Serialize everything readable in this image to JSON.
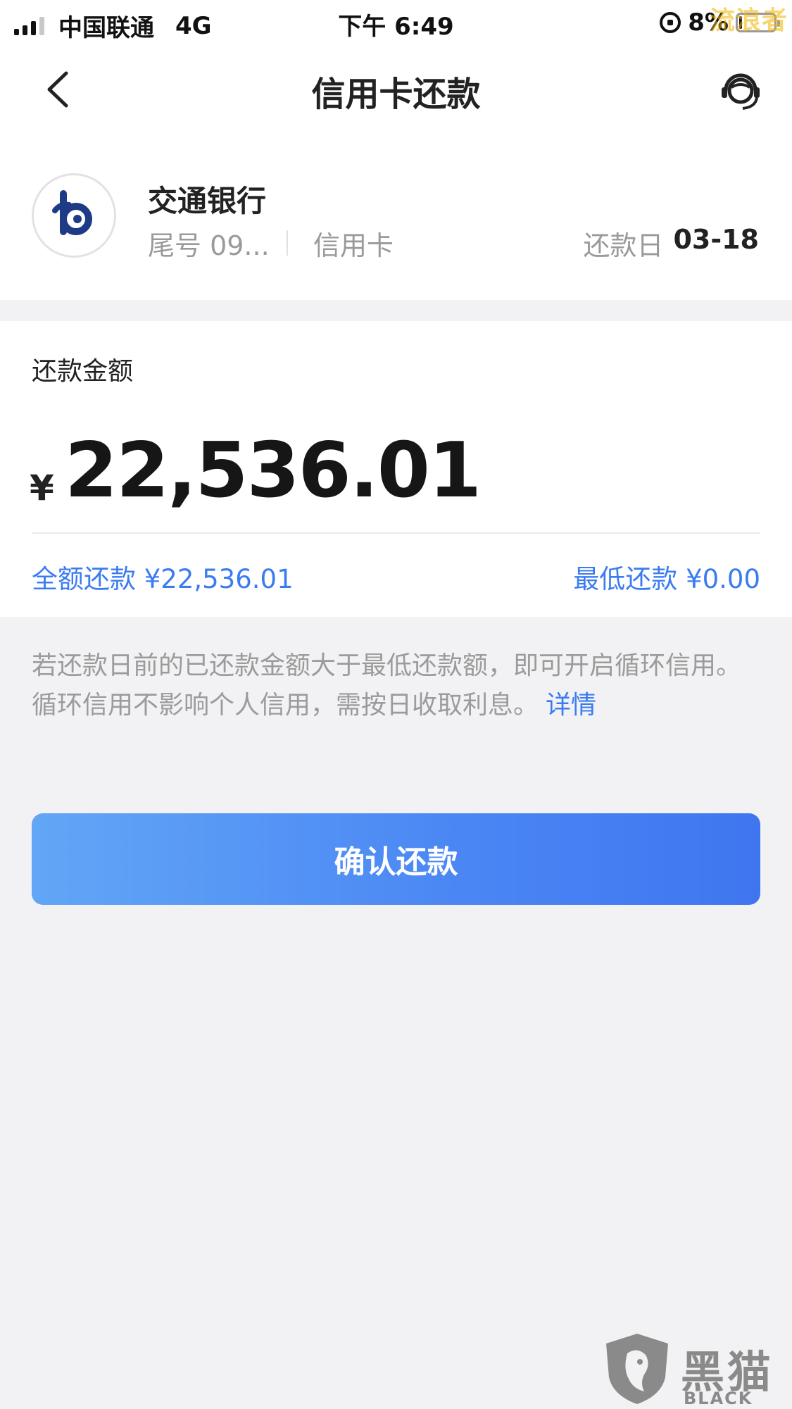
{
  "status_bar": {
    "carrier": "中国联通",
    "network": "4G",
    "time": "下午 6:49",
    "battery": "8%",
    "watermark": "流浪者"
  },
  "nav": {
    "title": "信用卡还款",
    "back_icon": "chevron-left-icon",
    "service_icon": "customer-service-icon"
  },
  "card": {
    "bank_name": "交通银行",
    "tail": "尾号 09...",
    "type": "信用卡",
    "due_label": "还款日",
    "due_date": "03-18"
  },
  "repayment": {
    "label": "还款金额",
    "currency": "¥",
    "amount": "22,536.01",
    "full_label": "全额还款 ¥22,536.01",
    "min_label": "最低还款 ¥0.00"
  },
  "note": {
    "text": "若还款日前的已还款金额大于最低还款额，即可开启循环信用。循环信用不影响个人信用，需按日收取利息。",
    "link": "详情"
  },
  "confirm_label": "确认还款",
  "watermark": {
    "cn": "黑猫",
    "en": "BLACK CAT"
  },
  "colors": {
    "accent": "#3b7bf0",
    "button_start": "#62a6f6",
    "button_end": "#3f76f0",
    "background": "#f2f2f4"
  }
}
